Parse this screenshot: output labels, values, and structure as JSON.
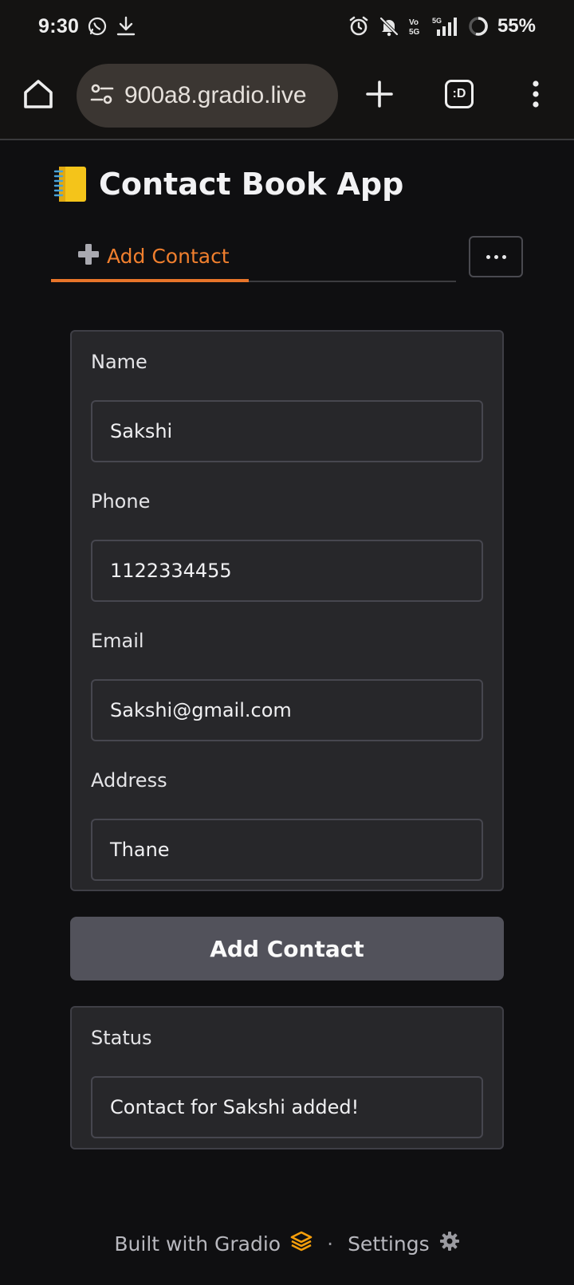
{
  "status_bar": {
    "time": "9:30",
    "battery": "55%",
    "left_icons": [
      "whatsapp-icon",
      "download-icon"
    ],
    "right_icons": [
      "alarm-icon",
      "bell-muted-icon",
      "volte-icon",
      "signal-5g-icon",
      "battery-ring-icon"
    ],
    "volte_text": "Vo 5G",
    "network_text": "5G"
  },
  "browser": {
    "url": "900a8.gradio.live",
    "tabs_label": ":D"
  },
  "app": {
    "title_emoji": "notebook-icon",
    "title": "Contact Book App",
    "tabs": [
      {
        "icon": "➕",
        "label": "Add Contact",
        "active": true
      }
    ],
    "more_button": "more-options-icon"
  },
  "form": {
    "fields": [
      {
        "label": "Name",
        "value": "Sakshi"
      },
      {
        "label": "Phone",
        "value": "1122334455"
      },
      {
        "label": "Email",
        "value": "Sakshi@gmail.com"
      },
      {
        "label": "Address",
        "value": "Thane"
      }
    ],
    "submit_label": "Add Contact"
  },
  "status": {
    "label": "Status",
    "value": "Contact for Sakshi  added!"
  },
  "footer": {
    "built_with": "Built with Gradio",
    "separator": "·",
    "settings": "Settings"
  },
  "colors": {
    "accent": "#f07f2e",
    "background": "#0f0f11",
    "panel": "#27272a",
    "button": "#52525b"
  }
}
